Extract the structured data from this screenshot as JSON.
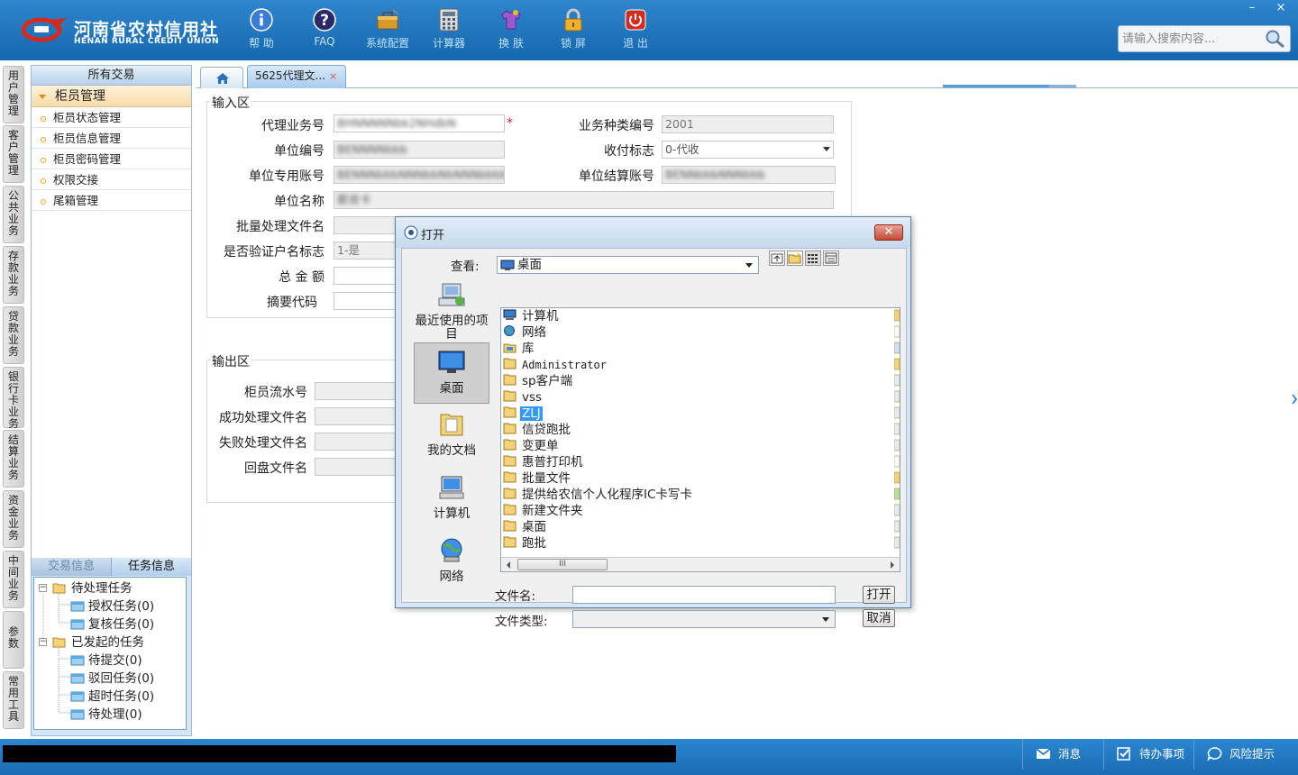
{
  "header": {
    "logo_cn": "河南省农村信用社",
    "logo_en": "HENAN RURAL CREDIT UNION",
    "tools": [
      {
        "label": "帮 助",
        "icon": "info-icon"
      },
      {
        "label": "FAQ",
        "icon": "question-icon"
      },
      {
        "label": "系统配置",
        "icon": "toolbox-icon"
      },
      {
        "label": "计算器",
        "icon": "calculator-icon"
      },
      {
        "label": "换 肤",
        "icon": "shirt-icon"
      },
      {
        "label": "锁 屏",
        "icon": "lock-icon"
      },
      {
        "label": "退 出",
        "icon": "power-icon"
      }
    ],
    "search_placeholder": "请输入搜索内容..."
  },
  "window_controls": {
    "minimize": "–",
    "close": "×"
  },
  "vertical_tabs": [
    "用户管理",
    "客户管理",
    "公共业务",
    "存款业务",
    "贷款业务",
    "银行卡业务",
    "结算业务",
    "资金业务",
    "中间业务",
    "参数",
    "常用工具"
  ],
  "left_panel": {
    "title": "所有交易",
    "group": "柜员管理",
    "items": [
      "柜员状态管理",
      "柜员信息管理",
      "柜员密码管理",
      "权限交接",
      "尾箱管理"
    ],
    "tabs": [
      "交易信息",
      "任务信息"
    ],
    "tree": [
      {
        "label": "待处理任务",
        "level": 0
      },
      {
        "label": "授权任务(0)",
        "level": 1
      },
      {
        "label": "复核任务(0)",
        "level": 1
      },
      {
        "label": "已发起的任务",
        "level": 0
      },
      {
        "label": "待提交(0)",
        "level": 1
      },
      {
        "label": "驳回任务(0)",
        "level": 1
      },
      {
        "label": "超时任务(0)",
        "level": 1
      },
      {
        "label": "待处理(0)",
        "level": 1
      }
    ]
  },
  "content_tabs": {
    "doc_tab": "5625代理文...",
    "close": "×"
  },
  "form": {
    "input_legend": "输入区",
    "output_legend": "输出区",
    "fields": {
      "agent_biz_no": {
        "label": "代理业务号",
        "value": "BHNNNNNbk2NHdbN"
      },
      "unit_no": {
        "label": "单位编号",
        "value": "BENNNNbbb"
      },
      "unit_account": {
        "label": "单位专用账号",
        "value": "BENNNbbbNNNbbNbNNNbbbbN"
      },
      "unit_name": {
        "label": "单位名称",
        "value": "薪资卡"
      },
      "batch_file": {
        "label": "批量处理文件名",
        "value": ""
      },
      "verify_flag": {
        "label": "是否验证户名标志",
        "value": "1-是"
      },
      "total_amount": {
        "label": "总 金 额",
        "value": ""
      },
      "summary_code": {
        "label": "摘要代码",
        "value": ""
      },
      "biz_type_no": {
        "label": "业务种类编号",
        "value": "2001"
      },
      "pay_flag": {
        "label": "收付标志",
        "value": "0-代收"
      },
      "settle_account": {
        "label": "单位结算账号",
        "value": "BENNbbbNNNbbb"
      }
    },
    "output_fields": [
      "柜员流水号",
      "成功处理文件名",
      "失败处理文件名",
      "回盘文件名"
    ]
  },
  "dialog": {
    "title": "打开",
    "lookin_label": "查看:",
    "lookin_value": "桌面",
    "places": [
      "最近使用的项目",
      "桌面",
      "我的文档",
      "计算机",
      "网络"
    ],
    "files": [
      {
        "name": "计算机",
        "icon": "computer-icon"
      },
      {
        "name": "网络",
        "icon": "network-icon"
      },
      {
        "name": "库",
        "icon": "library-icon"
      },
      {
        "name": "Administrator",
        "icon": "folder-icon"
      },
      {
        "name": "sp客户端",
        "icon": "folder-icon"
      },
      {
        "name": "vss",
        "icon": "folder-icon"
      },
      {
        "name": "ZLJ",
        "icon": "folder-icon"
      },
      {
        "name": "信贷跑批",
        "icon": "folder-icon"
      },
      {
        "name": "变更单",
        "icon": "folder-icon"
      },
      {
        "name": "惠普打印机",
        "icon": "folder-icon"
      },
      {
        "name": "批量文件",
        "icon": "folder-icon"
      },
      {
        "name": "提供给农信个人化程序IC卡写卡",
        "icon": "folder-icon"
      },
      {
        "name": "新建文件夹",
        "icon": "folder-icon"
      },
      {
        "name": "桌面",
        "icon": "folder-icon"
      },
      {
        "name": "跑批",
        "icon": "folder-icon"
      }
    ],
    "selected_file": "ZLJ",
    "filename_label": "文件名:",
    "filetype_label": "文件类型:",
    "filename_value": "",
    "open_button": "打开",
    "cancel_button": "取消",
    "hscroll_grip": "III"
  },
  "status_bar": {
    "message": "消息",
    "todo": "待办事项",
    "risk": "风险提示"
  }
}
